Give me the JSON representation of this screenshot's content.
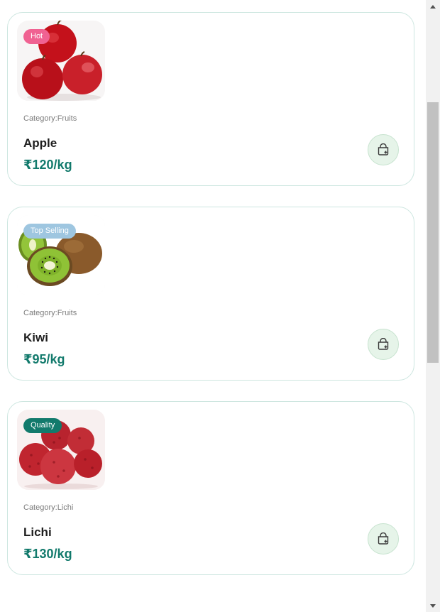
{
  "products": [
    {
      "badge": "Hot",
      "badge_color": "#f06292",
      "image_icon": "apple-image",
      "category": "Category:Fruits",
      "name": "Apple",
      "price": "₹120/kg",
      "cart_icon": "add-to-bag-icon"
    },
    {
      "badge": "Top Selling",
      "badge_color": "#9ec6e0",
      "image_icon": "kiwi-image",
      "category": "Category:Fruits",
      "name": "Kiwi",
      "price": "₹95/kg",
      "cart_icon": "add-to-bag-icon"
    },
    {
      "badge": "Quality",
      "badge_color": "#127a6c",
      "image_icon": "lichi-image",
      "category": "Category:Lichi",
      "name": "Lichi",
      "price": "₹130/kg",
      "cart_icon": "add-to-bag-icon"
    }
  ],
  "theme": {
    "accent": "#127a6c",
    "card_border": "#cde6e0",
    "cart_button_bg": "#e6f4e9"
  }
}
